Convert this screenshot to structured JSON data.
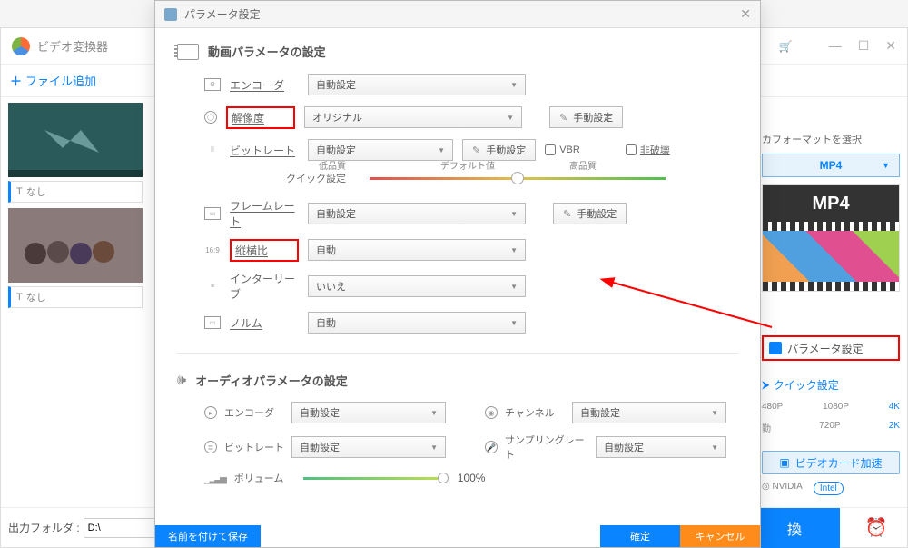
{
  "main": {
    "app_title": "ビデオ変換器",
    "add_file": "ファイル追加",
    "thumb_label": "なし",
    "output_folder_label": "出力フォルダ :",
    "output_folder_path": "D:\\",
    "convert_btn": "換",
    "right": {
      "format_title": "カフォーマットを選択",
      "format_value": "MP4",
      "mp4_badge": "MP4",
      "param_link": "パラメータ設定",
      "quick_btn": "クイック設定",
      "res_row1": [
        "480P",
        "1080P",
        "4K"
      ],
      "res_row2": [
        "勤",
        "720P",
        "2K"
      ],
      "gpu_accel": "ビデオカード加速",
      "nvidia": "NVIDIA",
      "intel": "Intel"
    }
  },
  "modal": {
    "title": "パラメータ設定",
    "video": {
      "section_title": "動画パラメータの設定",
      "encoder_label": "エンコーダ",
      "encoder_value": "自動設定",
      "resolution_label": "解像度",
      "resolution_value": "オリジナル",
      "manual_btn": "手動設定",
      "bitrate_label": "ビットレート",
      "bitrate_value": "自動設定",
      "vbr_label": "VBR",
      "lossless_label": "非破壊",
      "quick_label": "クイック設定",
      "quality_low": "低品質",
      "quality_default": "デフォルト値",
      "quality_high": "高品質",
      "framerate_label": "フレームレート",
      "framerate_value": "自動設定",
      "aspect_label": "縦横比",
      "aspect_value": "自動",
      "interleave_label": "インターリーブ",
      "interleave_value": "いいえ",
      "norm_label": "ノルム",
      "norm_value": "自動"
    },
    "audio": {
      "section_title": "オーディオパラメータの設定",
      "encoder_label": "エンコーダ",
      "encoder_value": "自動設定",
      "channel_label": "チャンネル",
      "channel_value": "自動設定",
      "bitrate_label": "ビットレート",
      "bitrate_value": "自動設定",
      "samplerate_label": "サンプリングレート",
      "samplerate_value": "自動設定",
      "volume_label": "ボリューム",
      "volume_value": "100%"
    },
    "footer": {
      "save_as": "名前を付けて保存",
      "ok": "確定",
      "cancel": "キャンセル"
    }
  }
}
